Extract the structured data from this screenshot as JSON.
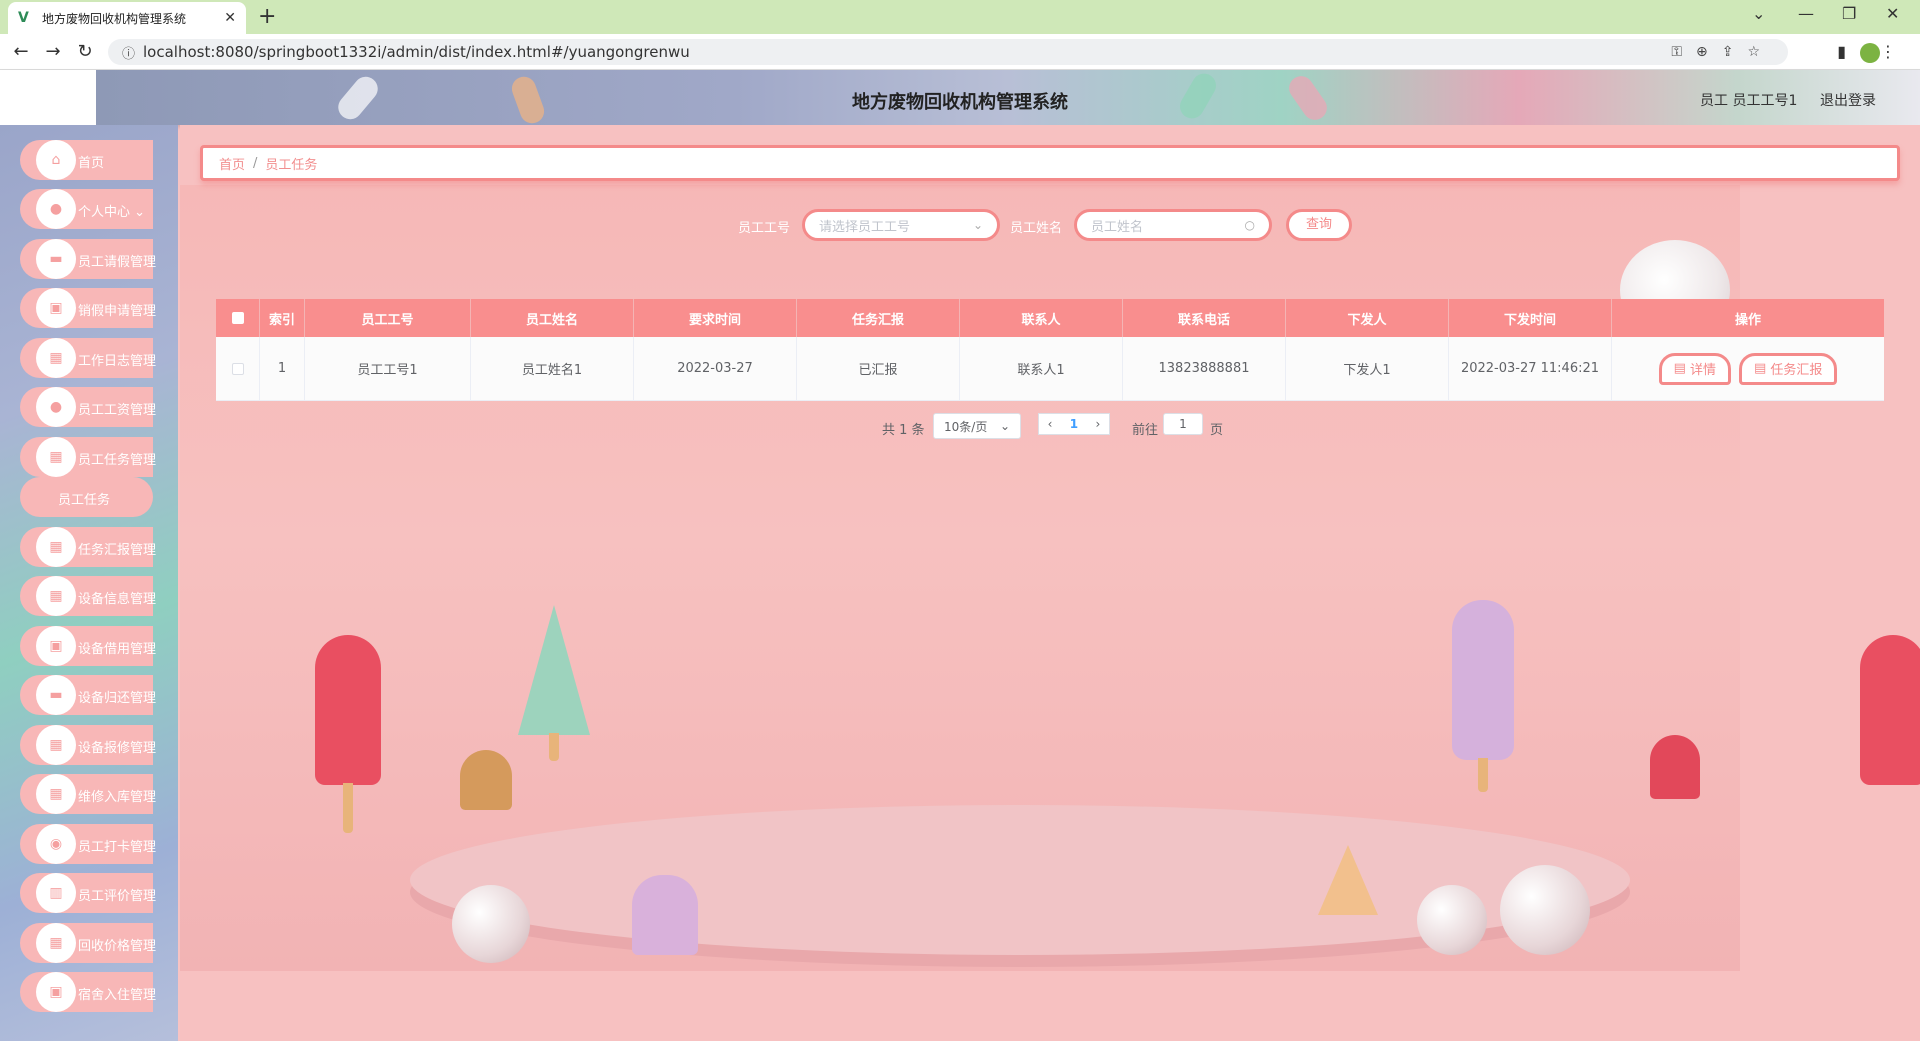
{
  "browser": {
    "tab_title": "地方废物回收机构管理系统",
    "tab_close": "✕",
    "new_tab": "+",
    "url": "localhost:8080/springboot1332i/admin/dist/index.html#/yuangongrenwu"
  },
  "header": {
    "title": "地方废物回收机构管理系统",
    "user": "员工 员工工号1",
    "logout": "退出登录"
  },
  "sidebar": {
    "items": [
      {
        "label": "首页",
        "icon": "home-icon",
        "glyph": "⌂"
      },
      {
        "label": "个人中心 ⌄",
        "icon": "user-icon",
        "glyph": "●"
      },
      {
        "label": "员工请假管理",
        "icon": "chat-icon",
        "glyph": "▬"
      },
      {
        "label": "销假申请管理",
        "icon": "briefcase-icon",
        "glyph": "▣"
      },
      {
        "label": "工作日志管理",
        "icon": "grid-icon",
        "glyph": "▦"
      },
      {
        "label": "员工工资管理",
        "icon": "person-icon",
        "glyph": "●"
      },
      {
        "label": "员工任务管理",
        "icon": "grid-icon",
        "glyph": "▦"
      },
      {
        "label": "任务汇报管理",
        "icon": "grid-icon",
        "glyph": "▦"
      },
      {
        "label": "设备信息管理",
        "icon": "grid-icon",
        "glyph": "▦"
      },
      {
        "label": "设备借用管理",
        "icon": "box-icon",
        "glyph": "▣"
      },
      {
        "label": "设备归还管理",
        "icon": "chat-icon",
        "glyph": "▬"
      },
      {
        "label": "设备报修管理",
        "icon": "grid-icon",
        "glyph": "▦"
      },
      {
        "label": "维修入库管理",
        "icon": "grid-icon",
        "glyph": "▦"
      },
      {
        "label": "员工打卡管理",
        "icon": "location-icon",
        "glyph": "◉"
      },
      {
        "label": "员工评价管理",
        "icon": "chart-icon",
        "glyph": "▥"
      },
      {
        "label": "回收价格管理",
        "icon": "grid-icon",
        "glyph": "▦"
      },
      {
        "label": "宿舍入住管理",
        "icon": "box-icon",
        "glyph": "▣"
      }
    ],
    "submenu_active": "员工任务"
  },
  "breadcrumb": {
    "home": "首页",
    "sep": "/",
    "current": "员工任务"
  },
  "search": {
    "field1_label": "员工工号",
    "field1_placeholder": "请选择员工工号",
    "field2_label": "员工姓名",
    "field2_placeholder": "员工姓名",
    "query_button": "查询"
  },
  "table": {
    "columns": [
      "索引",
      "员工工号",
      "员工姓名",
      "要求时间",
      "任务汇报",
      "联系人",
      "联系电话",
      "下发人",
      "下发时间",
      "操作"
    ],
    "rows": [
      {
        "index": "1",
        "emp_no": "员工工号1",
        "emp_name": "员工姓名1",
        "required_time": "2022-03-27",
        "report": "已汇报",
        "contact": "联系人1",
        "phone": "13823888881",
        "issuer": "下发人1",
        "issue_time": "2022-03-27 11:46:21",
        "btn_detail": "详情",
        "btn_report": "任务汇报"
      }
    ]
  },
  "pagination": {
    "total": "共 1 条",
    "page_size": "10条/页",
    "current_page": "1",
    "goto_prefix": "前往",
    "goto_value": "1",
    "goto_suffix": "页"
  },
  "colors": {
    "accent": "#f48a8a",
    "header_row": "#f98e8e",
    "sidebar_item": "#f8b7b7"
  }
}
